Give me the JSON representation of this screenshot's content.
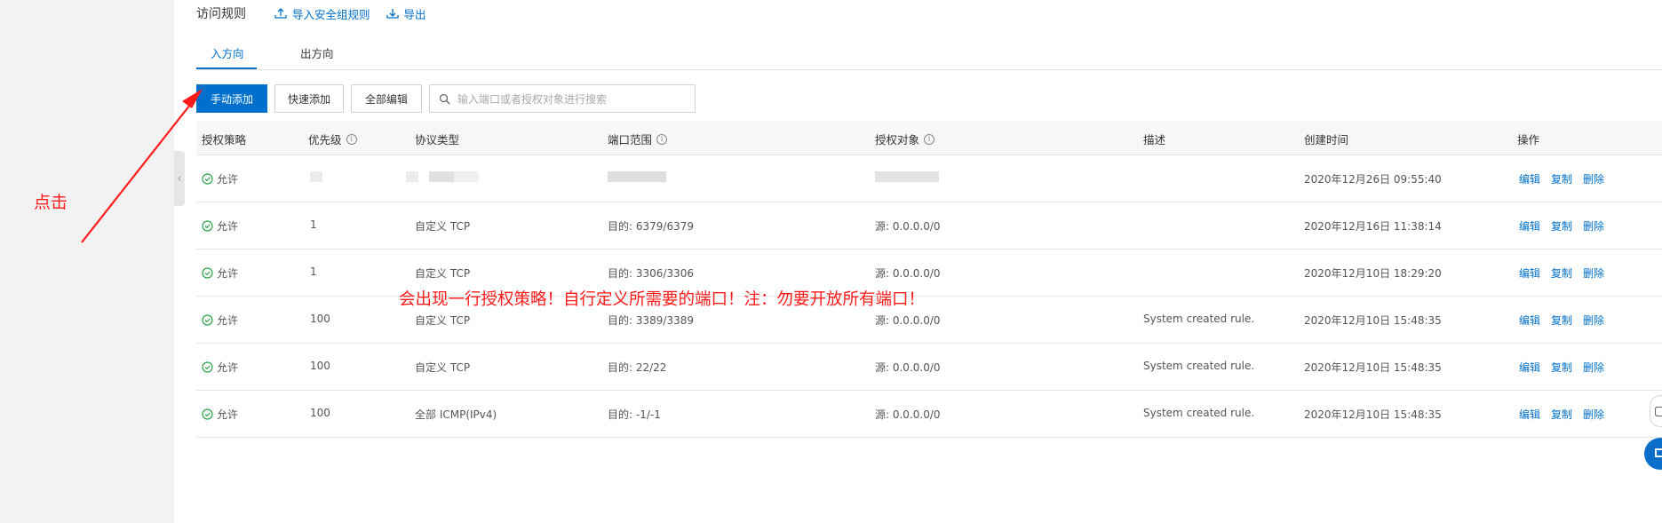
{
  "header": {
    "title": "访问规则",
    "import_label": "导入安全组规则",
    "export_label": "导出"
  },
  "tabs": [
    {
      "label": "入方向",
      "active": true
    },
    {
      "label": "出方向",
      "active": false
    }
  ],
  "toolbar": {
    "manual_add": "手动添加",
    "quick_add": "快速添加",
    "edit_all": "全部编辑",
    "search_placeholder": "输入端口或者授权对象进行搜索"
  },
  "table": {
    "columns": [
      "授权策略",
      "优先级",
      "协议类型",
      "端口范围",
      "授权对象",
      "描述",
      "创建时间",
      "操作"
    ],
    "row_actions": [
      "编辑",
      "复制",
      "删除"
    ],
    "rows": [
      {
        "policy": "允许",
        "priority": "",
        "protocol": "",
        "port": "",
        "object": "",
        "desc": "",
        "time": "2020年12月26日 09:55:40"
      },
      {
        "policy": "允许",
        "priority": "1",
        "protocol": "自定义 TCP",
        "port": "目的: 6379/6379",
        "object": "源: 0.0.0.0/0",
        "desc": "",
        "time": "2020年12月16日 11:38:14"
      },
      {
        "policy": "允许",
        "priority": "1",
        "protocol": "自定义 TCP",
        "port": "目的: 3306/3306",
        "object": "源: 0.0.0.0/0",
        "desc": "",
        "time": "2020年12月10日 18:29:20"
      },
      {
        "policy": "允许",
        "priority": "100",
        "protocol": "自定义 TCP",
        "port": "目的: 3389/3389",
        "object": "源: 0.0.0.0/0",
        "desc": "System created rule.",
        "time": "2020年12月10日 15:48:35"
      },
      {
        "policy": "允许",
        "priority": "100",
        "protocol": "自定义 TCP",
        "port": "目的: 22/22",
        "object": "源: 0.0.0.0/0",
        "desc": "System created rule.",
        "time": "2020年12月10日 15:48:35"
      },
      {
        "policy": "允许",
        "priority": "100",
        "protocol": "全部 ICMP(IPv4)",
        "port": "目的: -1/-1",
        "object": "源: 0.0.0.0/0",
        "desc": "System created rule.",
        "time": "2020年12月10日 15:48:35"
      }
    ]
  },
  "annotations": {
    "click": "点击",
    "note": "会出现一行授权策略！自行定义所需要的端口！注：勿要开放所有端口！"
  },
  "colors": {
    "accent": "#0070cc",
    "annotation": "#ff1a1a",
    "success": "#2aa34a"
  }
}
